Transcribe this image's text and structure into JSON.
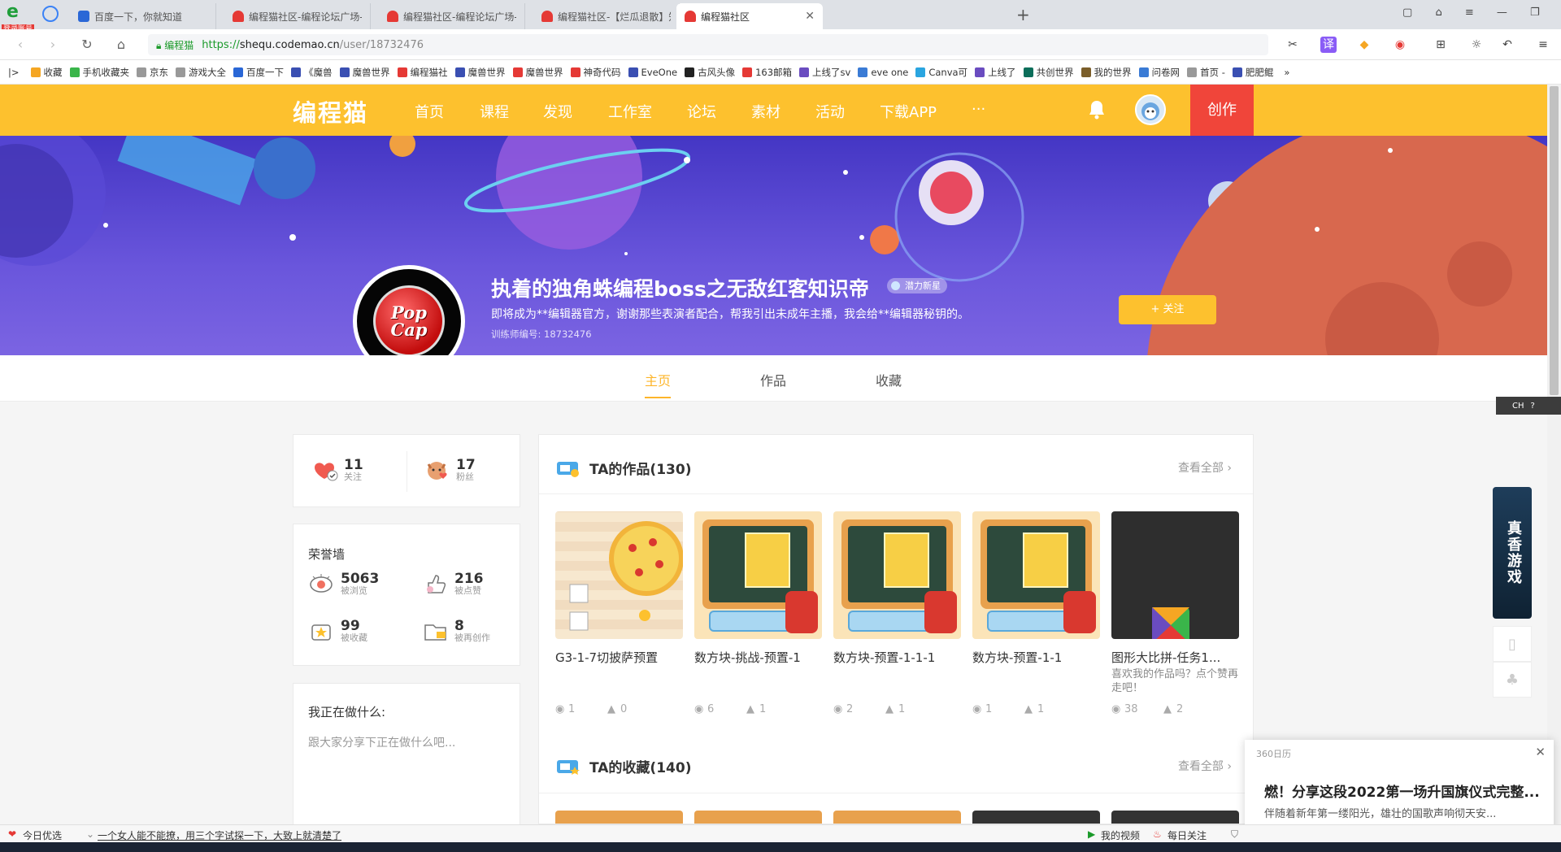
{
  "browser": {
    "login_badge": "登录账号",
    "tabs": [
      {
        "label": "百度一下，你就知道",
        "active": false
      },
      {
        "label": "编程猫社区-编程论坛广场-编程",
        "active": false
      },
      {
        "label": "编程猫社区-编程论坛广场-编程",
        "active": false
      },
      {
        "label": "编程猫社区-【烂瓜退散】知识",
        "active": false
      },
      {
        "label": "编程猫社区",
        "active": true
      }
    ],
    "address": {
      "site_label": "编程猫",
      "protocol": "https://",
      "host": "shequ.codemao.cn",
      "path": "/user/18732476"
    },
    "bookmarks": [
      "收藏",
      "手机收藏夹",
      "京东",
      "游戏大全",
      "百度一下",
      "《魔兽",
      "魔兽世界",
      "编程猫社",
      "魔兽世界",
      "魔兽世界",
      "神奇代码",
      "EveOne",
      "古风头像",
      "163邮箱",
      "上线了sv",
      "eve one",
      "Canva可",
      "上线了",
      "共创世界",
      "我的世界",
      "问卷网",
      "首页 -",
      "肥肥鲲"
    ],
    "bookmark_colors": [
      "#f5a623",
      "#3ab54a",
      "#999",
      "#999",
      "#2a67d6",
      "#3a4fb2",
      "#3a4fb2",
      "#e53935",
      "#3a4fb2",
      "#e53935",
      "#e53935",
      "#3a4fb2",
      "#222",
      "#e53935",
      "#6a4cc0",
      "#3a7bd5",
      "#2aa5e0",
      "#6a4cc0",
      "#0c6e5a",
      "#7b5e2a",
      "#3a7bd5",
      "#999",
      "#3a4fb2"
    ]
  },
  "site": {
    "logo": "编程猫",
    "nav": [
      "首页",
      "课程",
      "发现",
      "工作室",
      "论坛",
      "素材",
      "活动",
      "下载APP",
      "···"
    ],
    "create_label": "创作",
    "accent": "#fdc12e",
    "create_color": "#f0453a"
  },
  "profile": {
    "avatar_text": "Pop Cap",
    "name": "执着的独角蛛编程boss之无敌红客知识帝",
    "badge": "潜力新星",
    "bio": "即将成为**编辑器官方，谢谢那些表演者配合，帮我引出未成年主播，我会给**编辑器秘钥的。",
    "trainer_id": "训练师编号: 18732476",
    "follow_label": "+ 关注",
    "tabs": [
      "主页",
      "作品",
      "收藏"
    ]
  },
  "sidebar": {
    "follow": {
      "count": "11",
      "label": "关注"
    },
    "fans": {
      "count": "17",
      "label": "粉丝"
    },
    "honor_title": "荣誉墙",
    "honors": [
      {
        "count": "5063",
        "label": "被浏览",
        "icon": "eye-icon"
      },
      {
        "count": "216",
        "label": "被点赞",
        "icon": "thumb-icon"
      },
      {
        "count": "99",
        "label": "被收藏",
        "icon": "star-box-icon"
      },
      {
        "count": "8",
        "label": "被再创作",
        "icon": "folder-icon"
      }
    ],
    "doing_title": "我正在做什么:",
    "doing_placeholder": "跟大家分享下正在做什么吧..."
  },
  "works": {
    "title": "TA的作品(130)",
    "view_all": "查看全部 ›",
    "items": [
      {
        "title": "G3-1-7切披萨预置",
        "subtitle": "",
        "views": "1",
        "likes": "0",
        "thumb": "pizza"
      },
      {
        "title": "数方块-挑战-预置-1",
        "subtitle": "",
        "views": "6",
        "likes": "1",
        "thumb": "board"
      },
      {
        "title": "数方块-预置-1-1-1",
        "subtitle": "",
        "views": "2",
        "likes": "1",
        "thumb": "board"
      },
      {
        "title": "数方块-预置-1-1",
        "subtitle": "",
        "views": "1",
        "likes": "1",
        "thumb": "board"
      },
      {
        "title": "图形大比拼-任务1...",
        "subtitle": "喜欢我的作品吗？点个赞再走吧！",
        "views": "38",
        "likes": "2",
        "thumb": "dark"
      }
    ]
  },
  "collections": {
    "title": "TA的收藏(140)",
    "view_all": "查看全部 ›"
  },
  "floaters": {
    "ime": "CH",
    "game_ad": "真香游戏"
  },
  "popup": {
    "source": "360日历",
    "headline": "燃！分享这段2022第一场升国旗仪式完整...",
    "body": "伴随着新年第一缕阳光，雄壮的国歌声响彻天安..."
  },
  "statusbar": {
    "left_label": "今日优选",
    "news": "一个女人能不能撩，用三个字试探一下，大致上就清楚了",
    "video": "我的视频",
    "daily": "每日关注"
  }
}
